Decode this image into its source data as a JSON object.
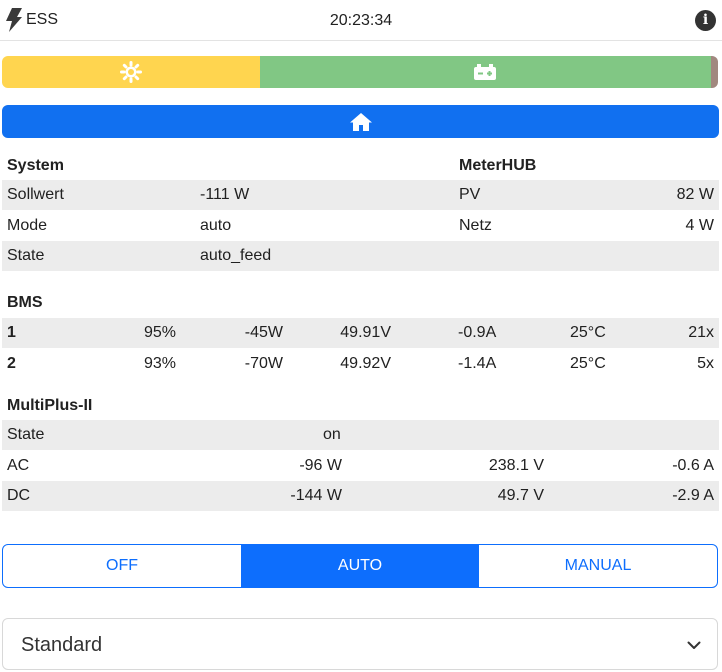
{
  "header": {
    "app_name": "ESS",
    "time": "20:23:34",
    "info_glyph": "i"
  },
  "icons": {
    "app": "bolt-icon",
    "solar": "sun-icon",
    "battery": "battery-icon",
    "home": "home-icon",
    "info": "info-icon",
    "select": "chevron-down-icon"
  },
  "power_bar": {
    "solar": {
      "fraction": 0.36,
      "color": "#ffd54f"
    },
    "battery": {
      "fraction": 0.63,
      "color": "#81c784"
    },
    "grid": {
      "fraction": 0.01,
      "color": "#a1887f"
    }
  },
  "system": {
    "title": "System",
    "rows": [
      {
        "label": "Sollwert",
        "value": "-111 W"
      },
      {
        "label": "Mode",
        "value": "auto"
      },
      {
        "label": "State",
        "value": "auto_feed"
      }
    ]
  },
  "meterhub": {
    "title": "MeterHUB",
    "rows": [
      {
        "label": "PV",
        "value": "82 W"
      },
      {
        "label": "Netz",
        "value": "4 W"
      }
    ]
  },
  "bms": {
    "title": "BMS",
    "rows": [
      {
        "id": "1",
        "soc": "95%",
        "power": "-45W",
        "voltage": "49.91V",
        "current": "-0.9A",
        "temp": "25°C",
        "cycles": "21x"
      },
      {
        "id": "2",
        "soc": "93%",
        "power": "-70W",
        "voltage": "49.92V",
        "current": "-1.4A",
        "temp": "25°C",
        "cycles": "5x"
      }
    ]
  },
  "multiplus": {
    "title": "MultiPlus-II",
    "state": {
      "label": "State",
      "value": "on"
    },
    "ac": {
      "label": "AC",
      "power": "-96 W",
      "voltage": "238.1 V",
      "current": "-0.6 A"
    },
    "dc": {
      "label": "DC",
      "power": "-144 W",
      "voltage": "49.7 V",
      "current": "-2.9 A"
    }
  },
  "modes": {
    "off": "OFF",
    "auto": "AUTO",
    "manual": "MANUAL",
    "active": "AUTO",
    "accent": "#0d6efd"
  },
  "profile": {
    "selected": "Standard"
  }
}
